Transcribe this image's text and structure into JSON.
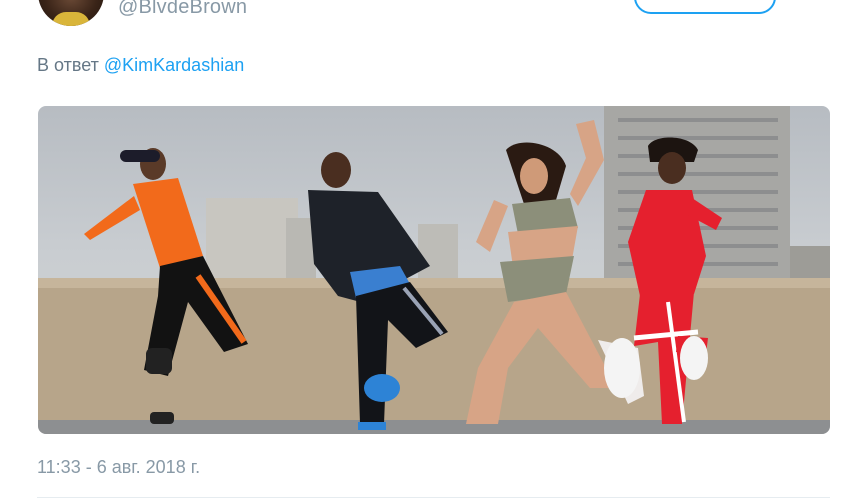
{
  "tweet": {
    "handle": "@BlvdeBrown",
    "reply_prefix": "В ответ ",
    "reply_to": "@KimKardashian",
    "timestamp": "11:33 - 6 авг. 2018 г."
  },
  "colors": {
    "accent": "#1da1f2",
    "secondary_text": "#8899a6",
    "reply_text": "#657786"
  },
  "media": {
    "description_icon": "photo"
  }
}
